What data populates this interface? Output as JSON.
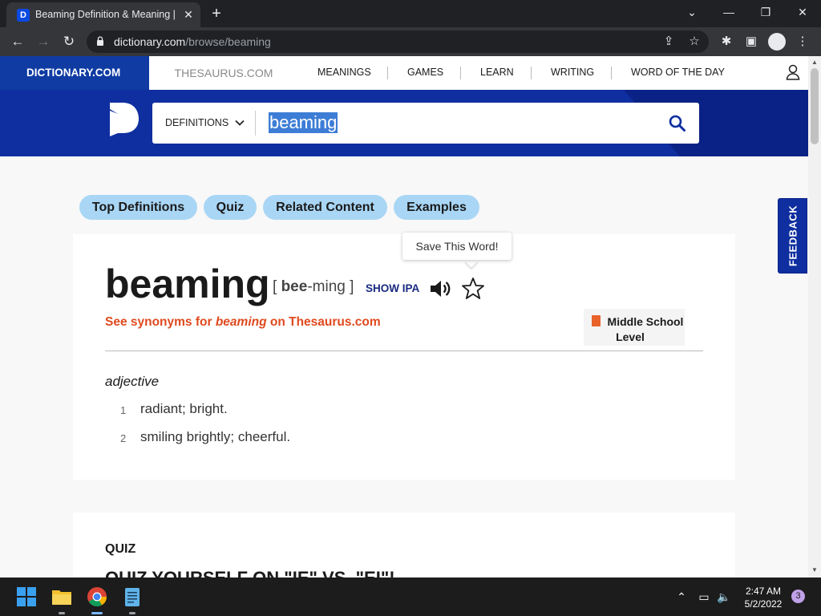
{
  "browser": {
    "tab_title": "Beaming Definition & Meaning | Dictionary.com",
    "tab_favicon": "D",
    "url_host": "dictionary.com",
    "url_path": "/browse/beaming"
  },
  "site": {
    "brand": "DICTIONARY.COM",
    "thesaurus": "THESAURUS.COM",
    "nav": [
      "MEANINGS",
      "GAMES",
      "LEARN",
      "WRITING",
      "WORD OF THE DAY"
    ]
  },
  "search": {
    "dropdown_label": "DEFINITIONS",
    "term": "beaming"
  },
  "pills": [
    "Top Definitions",
    "Quiz",
    "Related Content",
    "Examples"
  ],
  "entry": {
    "tooltip": "Save This Word!",
    "headword": "beaming",
    "pron_open": "[ ",
    "pron_bold": "bee",
    "pron_rest": "-ming",
    "pron_close": " ]",
    "show_ipa": "SHOW IPA",
    "syn_prefix": "See synonyms for ",
    "syn_word": "beaming",
    "syn_suffix": " on Thesaurus.com",
    "level_line1": "Middle School",
    "level_line2": "Level",
    "pos": "adjective",
    "definitions": [
      {
        "num": "1",
        "text": "radiant; bright."
      },
      {
        "num": "2",
        "text": "smiling brightly; cheerful."
      }
    ]
  },
  "quiz": {
    "title": "QUIZ",
    "subtitle": "QUIZ YOURSELF ON \"IE\" VS. \"EI\"!"
  },
  "feedback": "FEEDBACK",
  "taskbar": {
    "time": "2:47 AM",
    "date": "5/2/2022",
    "notifications": "3"
  },
  "colors": {
    "brand_blue": "#0f2fa0",
    "accent_orange": "#e04a1f",
    "pill_blue": "#a9d6f5"
  }
}
